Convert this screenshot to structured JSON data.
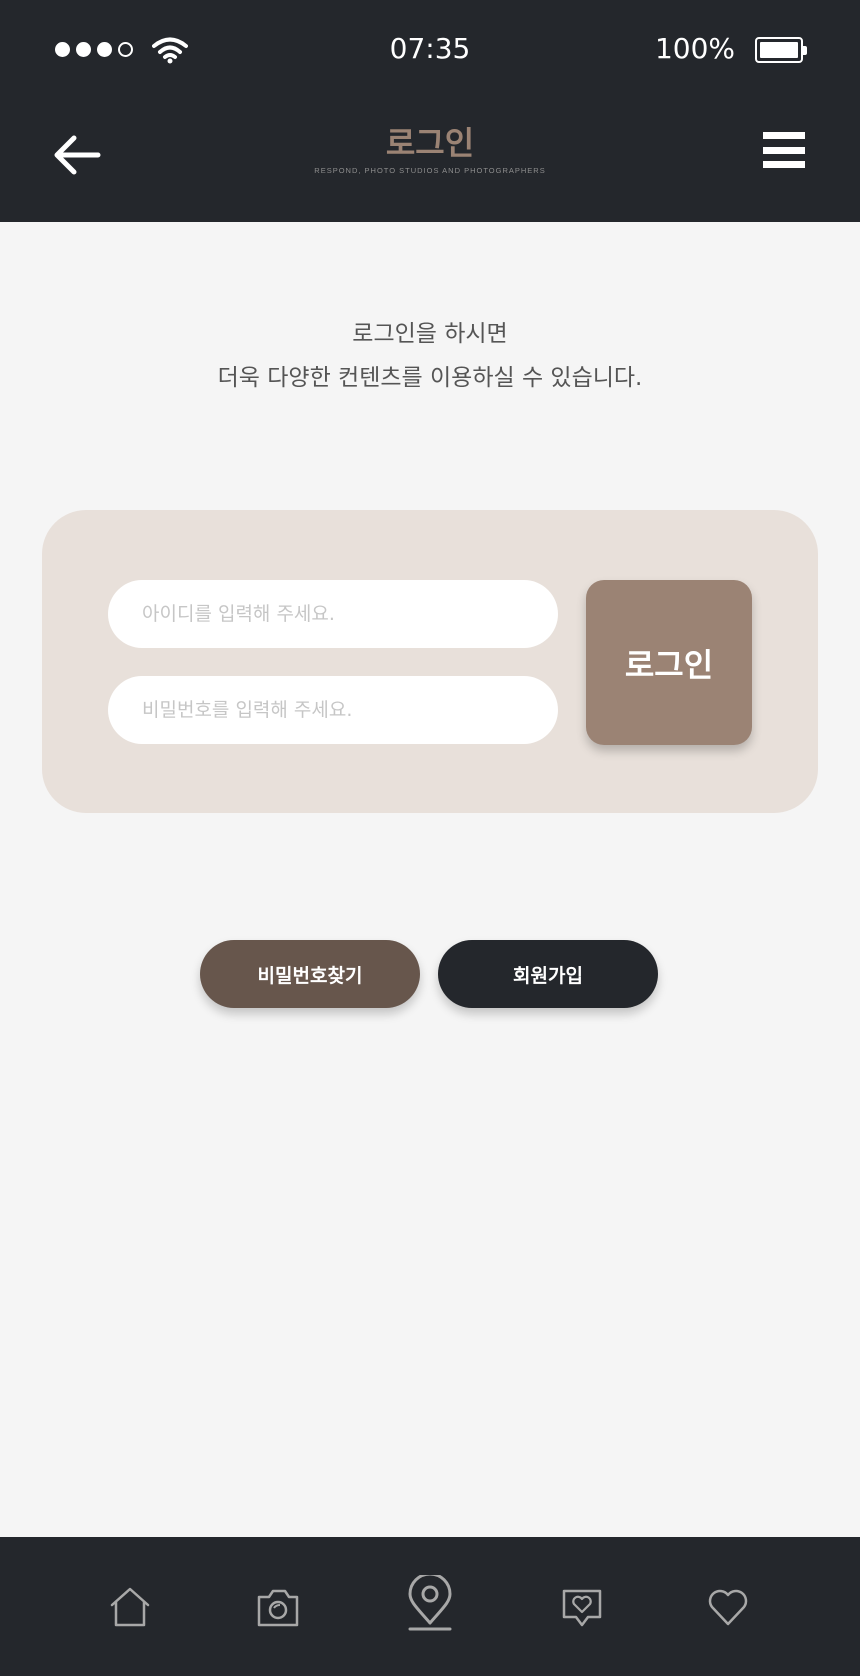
{
  "status_bar": {
    "time": "07:35",
    "battery_percent": "100%",
    "signal_level": 3,
    "signal_max": 4
  },
  "header": {
    "title": "로그인",
    "subtitle": "RESPOND, PHOTO STUDIOS AND PHOTOGRAPHERS",
    "back_icon": "arrow-left-icon",
    "menu_icon": "hamburger-icon"
  },
  "intro": {
    "line1": "로그인을 하시면",
    "line2": "더욱 다양한 컨텐츠를 이용하실 수 있습니다."
  },
  "login_form": {
    "id_placeholder": "아이디를 입력해 주세요.",
    "id_value": "",
    "password_placeholder": "비밀번호를 입력해 주세요.",
    "password_value": "",
    "login_label": "로그인"
  },
  "actions": {
    "find_password_label": "비밀번호찾기",
    "signup_label": "회원가입"
  },
  "tab_bar": {
    "items": [
      {
        "icon": "home-icon"
      },
      {
        "icon": "camera-icon"
      },
      {
        "icon": "location-pin-icon",
        "active": true
      },
      {
        "icon": "heart-chat-icon"
      },
      {
        "icon": "heart-icon"
      }
    ]
  },
  "colors": {
    "dark": "#24272c",
    "accent": "#9b8374",
    "accent_dark": "#67564c",
    "card": "#e8e0da",
    "background": "#f5f5f5"
  }
}
